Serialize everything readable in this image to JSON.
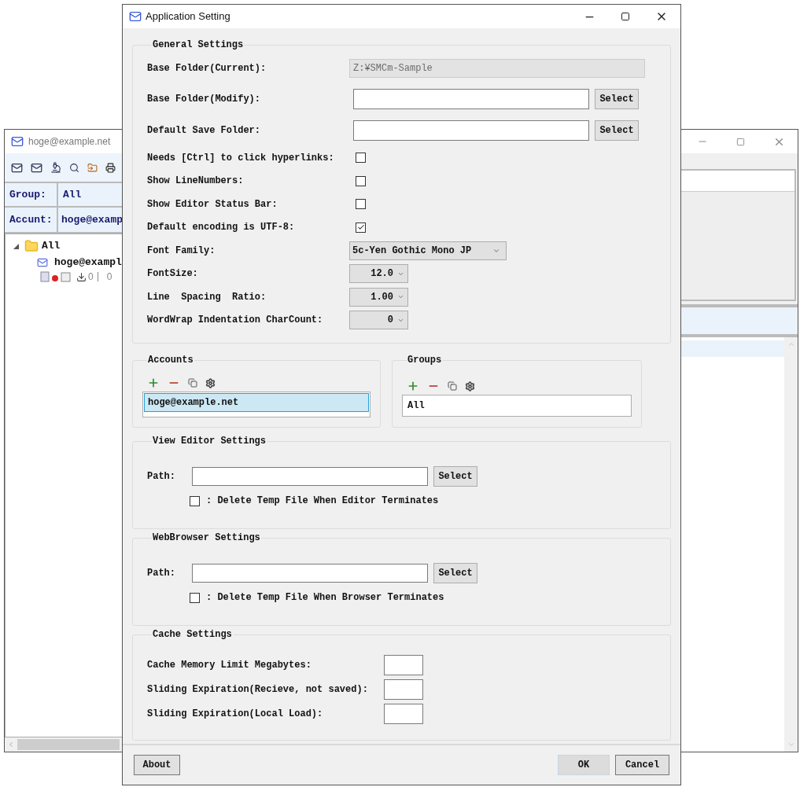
{
  "background_window": {
    "title": "hoge@example.net",
    "group": {
      "label": "Group:",
      "value": "All"
    },
    "account": {
      "label": "Accunt:",
      "value": "hoge@examp"
    },
    "tree": [
      {
        "label": "All",
        "expanded": true,
        "children": [
          {
            "label": "hoge@exampl",
            "counts": [
              "0",
              "0"
            ]
          }
        ]
      }
    ]
  },
  "dialog": {
    "title": "Application Setting",
    "general": {
      "title": "General Settings",
      "fields": [
        {
          "kind": "readonly",
          "label": "Base Folder(Current):",
          "value": "Z:¥SMCm-Sample"
        },
        {
          "kind": "path",
          "label": "Base Folder(Modify):",
          "button": "Select"
        },
        {
          "kind": "path",
          "label": "Default Save Folder:",
          "button": "Select"
        },
        {
          "kind": "checkbox",
          "label": "Needs [Ctrl] to click hyperlinks:",
          "checked": false
        },
        {
          "kind": "checkbox",
          "label": "Show LineNumbers:",
          "checked": false
        },
        {
          "kind": "checkbox",
          "label": "Show Editor Status Bar:",
          "checked": false
        },
        {
          "kind": "checkbox",
          "label": "Default encoding is UTF-8:",
          "checked": true
        },
        {
          "kind": "select",
          "label": "Font Family:",
          "value": "5c-Yen Gothic Mono JP"
        },
        {
          "kind": "number",
          "label": "FontSize:",
          "value": "12.0"
        },
        {
          "kind": "number",
          "label": "Line  Spacing  Ratio:",
          "value": "1.00"
        },
        {
          "kind": "number",
          "label": "WordWrap Indentation CharCount:",
          "value": "0"
        }
      ]
    },
    "accounts": {
      "title": "Accounts",
      "items": [
        {
          "label": "hoge@example.net",
          "selected": true
        }
      ]
    },
    "groups": {
      "title": "Groups",
      "items": [
        {
          "label": "All",
          "selected": false
        }
      ]
    },
    "view_editor": {
      "title": "View Editor Settings",
      "path_label": "Path:",
      "button": "Select",
      "option": {
        "label": ": Delete Temp File When Editor Terminates",
        "checked": false
      }
    },
    "web_browser": {
      "title": "WebBrowser Settings",
      "path_label": "Path:",
      "button": "Select",
      "option": {
        "label": ": Delete Temp File When Browser Terminates",
        "checked": false
      }
    },
    "cache": {
      "title": "Cache Settings",
      "fields": [
        {
          "label": "Cache Memory Limit Megabytes:"
        },
        {
          "label": "Sliding Expiration(Recieve, not saved):"
        },
        {
          "label": "Sliding Expiration(Local Load):"
        }
      ]
    },
    "footer": {
      "about": "About",
      "ok": "OK",
      "cancel": "Cancel"
    }
  }
}
